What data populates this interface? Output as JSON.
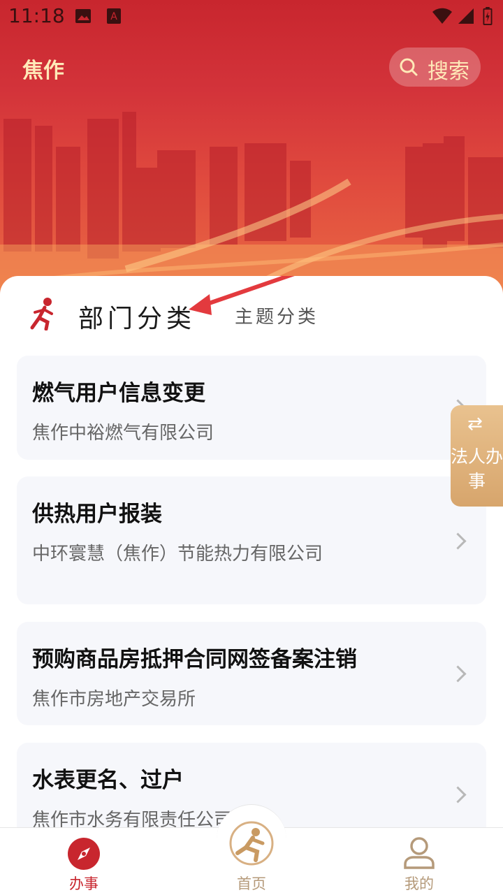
{
  "status_bar": {
    "time": "11:18"
  },
  "header": {
    "city": "焦作",
    "search_label": "搜索"
  },
  "tabs": {
    "department": "部门分类",
    "theme": "主题分类"
  },
  "services": [
    {
      "title": "燃气用户信息变更",
      "department": "焦作中裕燃气有限公司"
    },
    {
      "title": "供热用户报装",
      "department": "中环寰慧（焦作）节能热力有限公司"
    },
    {
      "title": "预购商品房抵押合同网签备案注销",
      "department": "焦作市房地产交易所"
    },
    {
      "title": "水表更名、过户",
      "department": "焦作市水务有限责任公司"
    }
  ],
  "floating": {
    "label": "法人办事",
    "icon": "swap-icon"
  },
  "bottom_nav": [
    {
      "label": "办事",
      "icon": "compass-icon",
      "active": true
    },
    {
      "label": "首页",
      "icon": "home-logo-icon",
      "active": false
    },
    {
      "label": "我的",
      "icon": "user-icon",
      "active": false
    }
  ],
  "colors": {
    "brand_red": "#c8262e",
    "accent_gold": "#ffe9b8",
    "nav_active": "#c8262e",
    "nav_inactive": "#b59a7a"
  }
}
